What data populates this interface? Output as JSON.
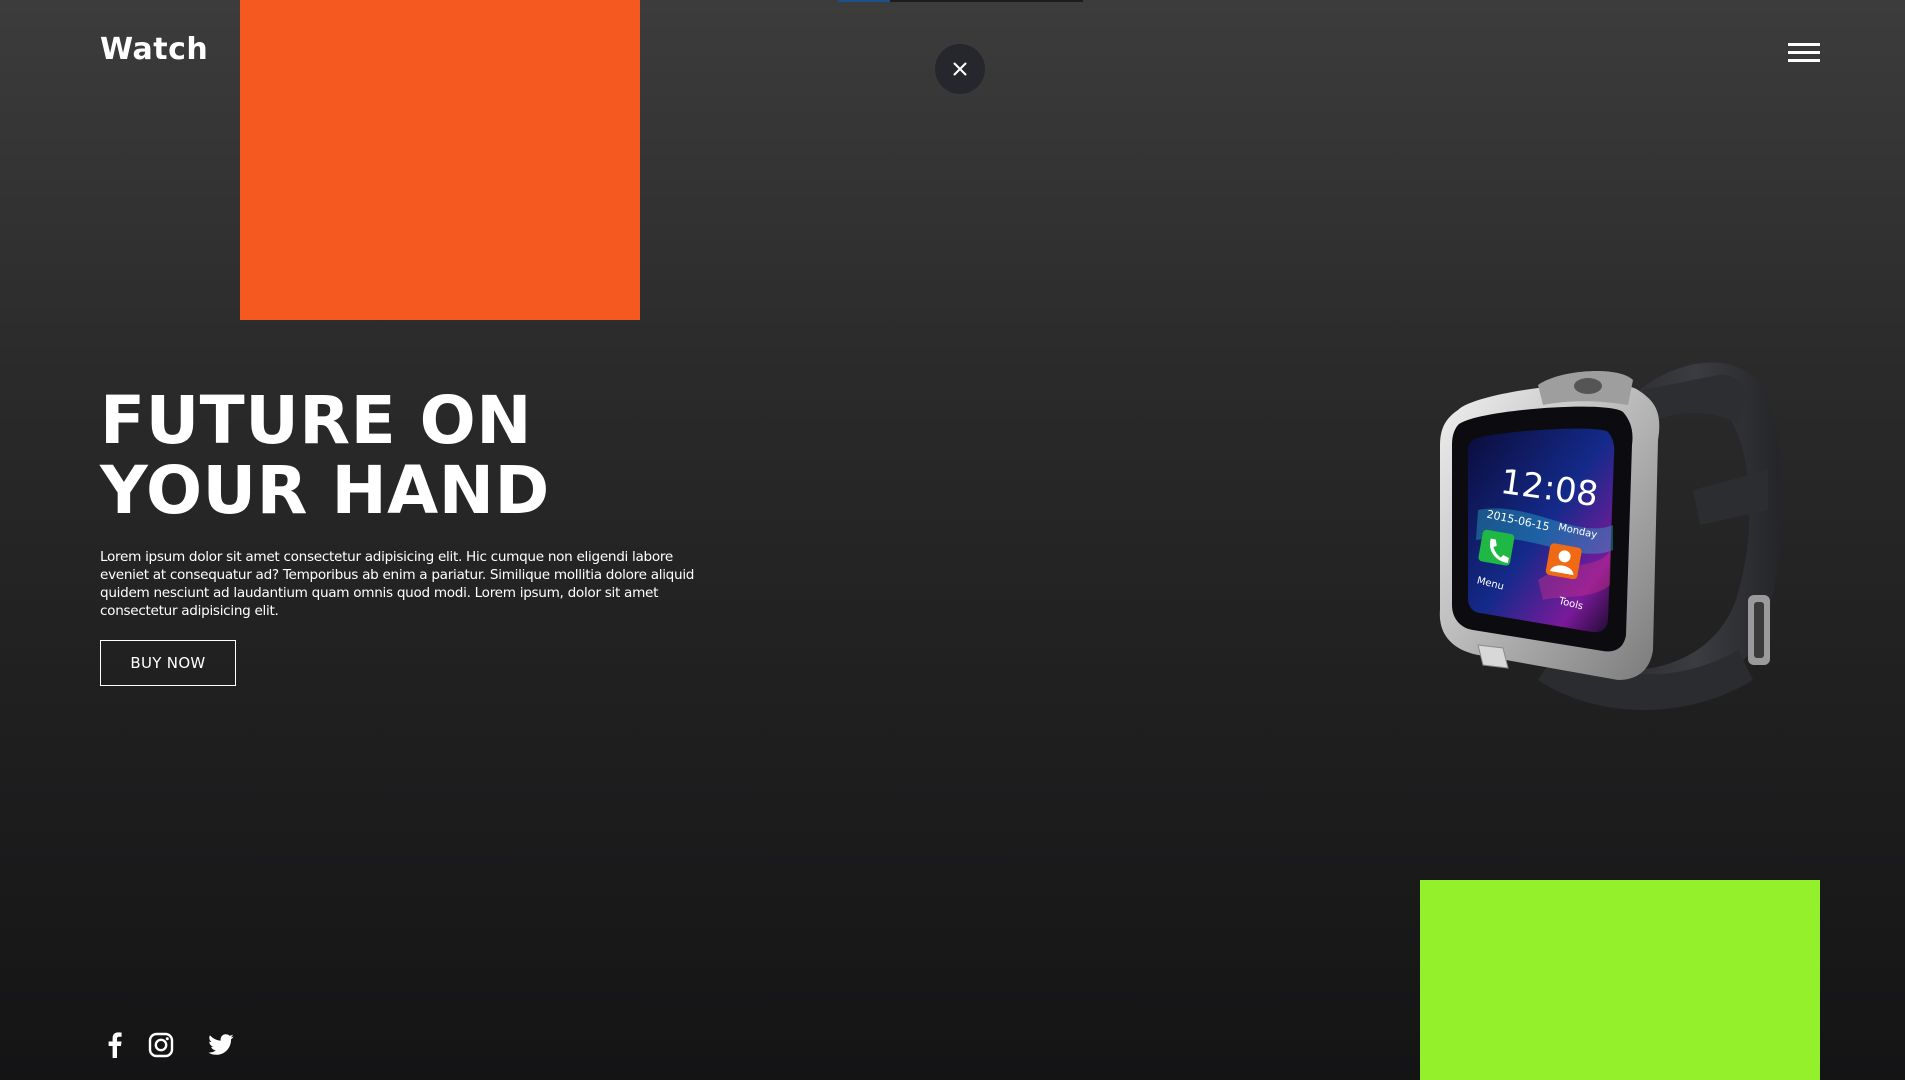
{
  "brand": {
    "name": "Watch"
  },
  "hero": {
    "headline_line1": "FUTURE ON",
    "headline_line2": "YOUR HAND",
    "description": "Lorem ipsum dolor sit amet consectetur adipisicing elit. Hic cumque non eligendi labore eveniet at consequatur ad? Temporibus ab enim a pariatur. Similique mollitia dolore aliquid quidem nesciunt ad laudantium quam omnis quod modi. Lorem ipsum, dolor sit amet consectetur adipisicing elit.",
    "cta_label": "BUY NOW"
  },
  "product": {
    "screen_time": "12:08",
    "screen_date": "2015-06-15",
    "screen_day": "Monday",
    "screen_menu_label": "Menu",
    "screen_tools_label": "Tools"
  },
  "overlay": {
    "close_icon": "close-icon"
  },
  "nav": {
    "menu_icon": "hamburger-menu-icon"
  },
  "socials": [
    {
      "icon": "facebook-icon"
    },
    {
      "icon": "instagram-icon"
    },
    {
      "icon": "twitter-icon"
    }
  ],
  "colors": {
    "accent_orange": "#f5591f",
    "accent_green": "#94f02a",
    "background_dark": "#1c1c1d"
  }
}
